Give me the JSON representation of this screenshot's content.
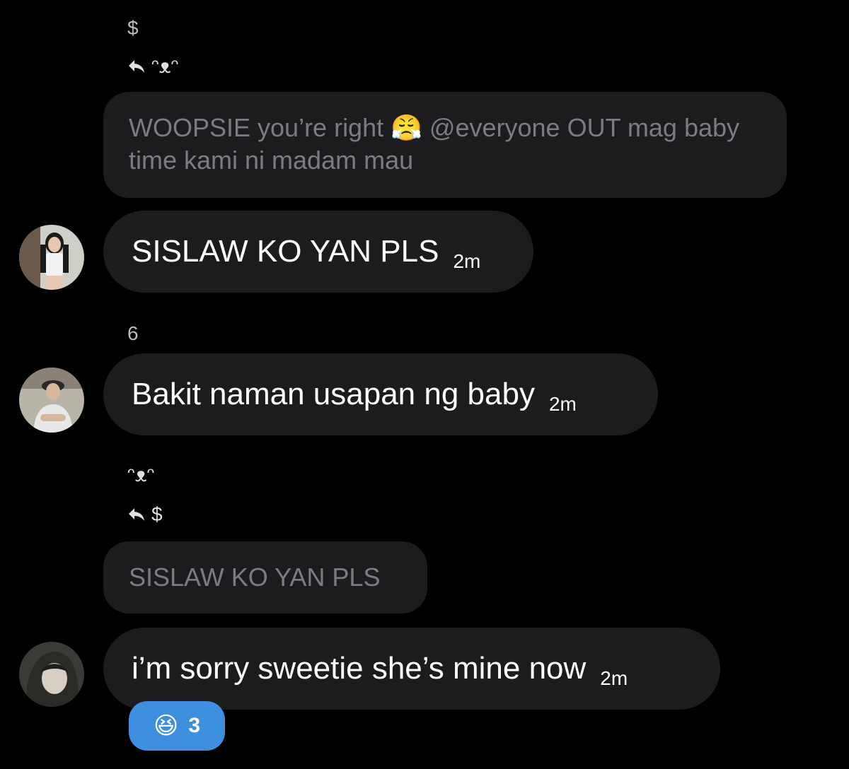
{
  "groups": [
    {
      "reply": {
        "author": "$",
        "replied_to": "ᵔᴥᵔ",
        "quoted_text": "WOOPSIE you’re right 😤 @everyone OUT mag baby time kami ni madam mau"
      },
      "message": {
        "text": "SISLAW KO YAN PLS",
        "time": "2m"
      }
    },
    {
      "sender": "6",
      "message": {
        "text": "Bakit naman usapan ng baby",
        "time": "2m"
      }
    },
    {
      "sender": "ᵔᴥᵔ",
      "reply": {
        "replied_to": "$",
        "quoted_text": "SISLAW KO YAN PLS"
      },
      "message": {
        "text": "i’m sorry sweetie she’s mine now",
        "time": "2m"
      },
      "reaction": {
        "emoji": "😆",
        "count": "3"
      }
    }
  ],
  "colors": {
    "background": "#000000",
    "bubble": "#1c1c1e",
    "quoted_text": "#7c7c80",
    "reaction_bg": "#3d8fe0"
  }
}
